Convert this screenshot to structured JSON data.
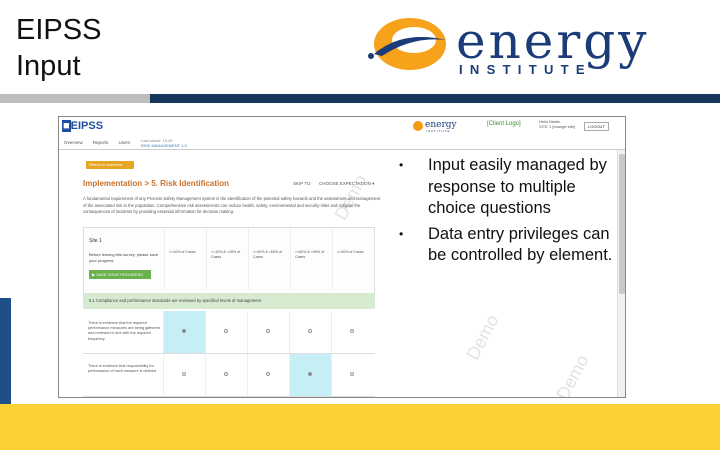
{
  "slide": {
    "title": "EIPSS\nInput",
    "logo_word": "energy",
    "logo_sub": "INSTITUTE",
    "bullets": [
      "Input easily managed by response to multiple choice questions",
      "Data entry privileges can be controlled by element."
    ]
  },
  "colors": {
    "navy": "#17365d",
    "gray": "#bdbdbd",
    "yellow": "#fcd133",
    "orange": "#f39c12",
    "brand_blue": "#1b3c78"
  },
  "screenshot": {
    "app_logo": "EIPSS",
    "mini_logo_word": "energy",
    "mini_logo_sub": "INSTITUTE",
    "client_logo": "[Client Logo]",
    "user_line1": "Hello Martin",
    "user_line2": "SITE 1 [change site]",
    "logout": "LOGOUT",
    "tabs": [
      "Overview",
      "Reports",
      "Users"
    ],
    "nav_info_1": "Last saved: 10:30",
    "nav_info_2": "RISK MANAGEMENT 1.0",
    "back": "Return to overview",
    "section_title": "Implementation > 5. Risk Identification",
    "skip_to": "SKIP TO",
    "choose_expectation": "CHOOSE EXPECTATION",
    "description": "A fundamental requirement of any Process Safety Management system is the identification of the potential safety hazards and the assessment and management of the associated risk to the population. Comprehensive risk assessments can reduce health, safety, environmental and security risks and mitigate the consequences of incidents by providing essential information for decision making.",
    "site_label": "Site 1",
    "before_leaving": "Before leaving this survey, please save your progress",
    "save_button": "SAVE YOUR PROGRESS",
    "options": [
      "<=10% of Cases",
      ">=10% & <40% of Cases",
      ">=40% & <60% of Cases",
      ">=60% & <90% of Cases",
      ">=90% of Cases"
    ],
    "requirement": "5.1   Compliance and performance standards are reviewed by specified levels of management",
    "questions": [
      {
        "text": "There is evidence that the required performance measures are being gathered and reviewed in line with the required frequency",
        "selected": 0
      },
      {
        "text": "There is evidence that responsibility for performance of each measure is defined",
        "selected": 3
      }
    ],
    "watermark": "Demo"
  }
}
